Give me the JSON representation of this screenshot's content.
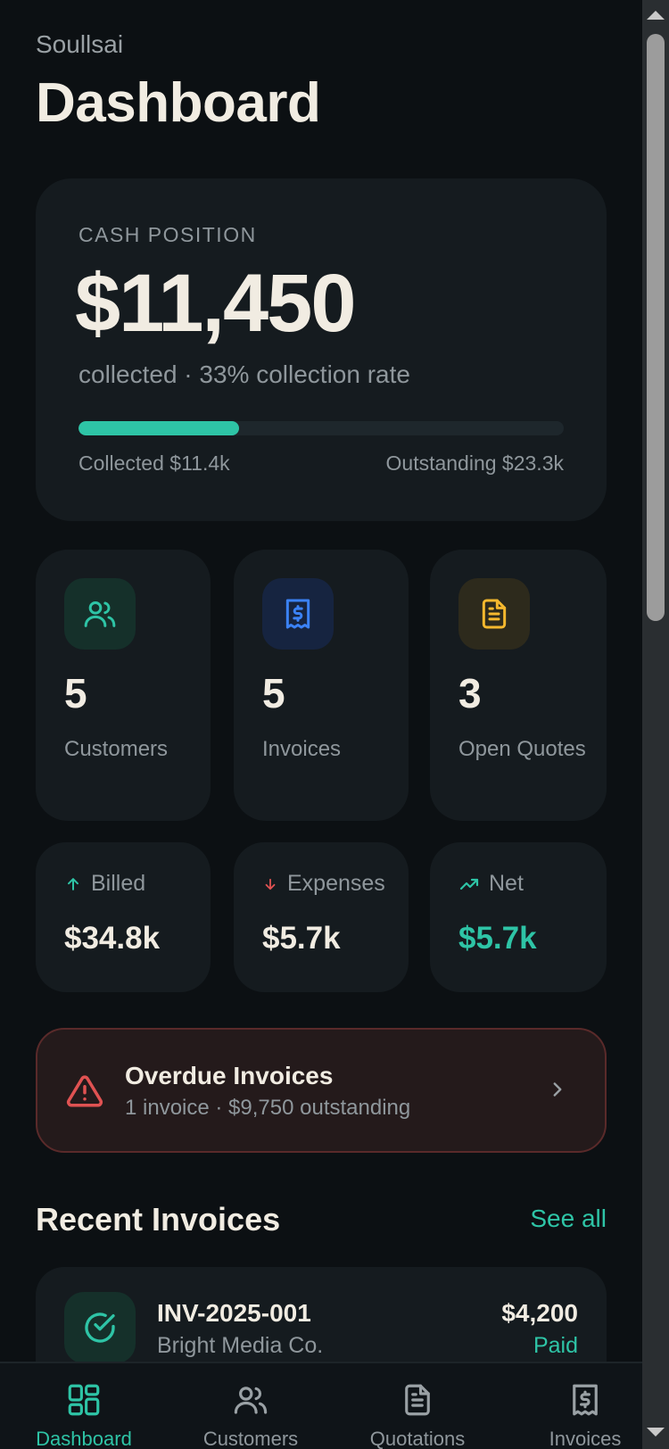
{
  "header": {
    "company": "Soullsai",
    "title": "Dashboard"
  },
  "cash": {
    "label": "CASH POSITION",
    "amount": "$11,450",
    "subtitle": "collected · 33% collection rate",
    "progress": 0.33,
    "collected": "Collected $11.4k",
    "outstanding": "Outstanding $23.3k"
  },
  "stats": [
    {
      "value": "5",
      "label": "Customers",
      "icon": "users-icon",
      "color": "#2ec4a6"
    },
    {
      "value": "5",
      "label": "Invoices",
      "icon": "receipt-icon",
      "color": "#3b82f6"
    },
    {
      "value": "3",
      "label": "Open Quotes",
      "icon": "document-icon",
      "color": "#f5b82e"
    }
  ],
  "money": [
    {
      "label": "Billed",
      "value": "$34.8k",
      "icon": "arrow-up-icon",
      "color": "#2ec4a6"
    },
    {
      "label": "Expenses",
      "value": "$5.7k",
      "icon": "arrow-down-icon",
      "color": "#e05252"
    },
    {
      "label": "Net",
      "value": "$5.7k",
      "icon": "trending-up-icon",
      "color": "#2ec4a6"
    }
  ],
  "overdue": {
    "title": "Overdue Invoices",
    "subtitle": "1 invoice · $9,750 outstanding"
  },
  "recent": {
    "title": "Recent Invoices",
    "see_all": "See all",
    "items": [
      {
        "number": "INV-2025-001",
        "customer": "Bright Media Co.",
        "amount": "$4,200",
        "status": "Paid"
      }
    ]
  },
  "nav": [
    {
      "label": "Dashboard",
      "icon": "dashboard-icon",
      "active": true
    },
    {
      "label": "Customers",
      "icon": "users-icon",
      "active": false
    },
    {
      "label": "Quotations",
      "icon": "document-icon",
      "active": false
    },
    {
      "label": "Invoices",
      "icon": "receipt-icon",
      "active": false
    }
  ],
  "colors": {
    "accent": "#2ec4a6",
    "background": "#0c1013",
    "card": "#151b1f",
    "danger": "#e05252"
  }
}
